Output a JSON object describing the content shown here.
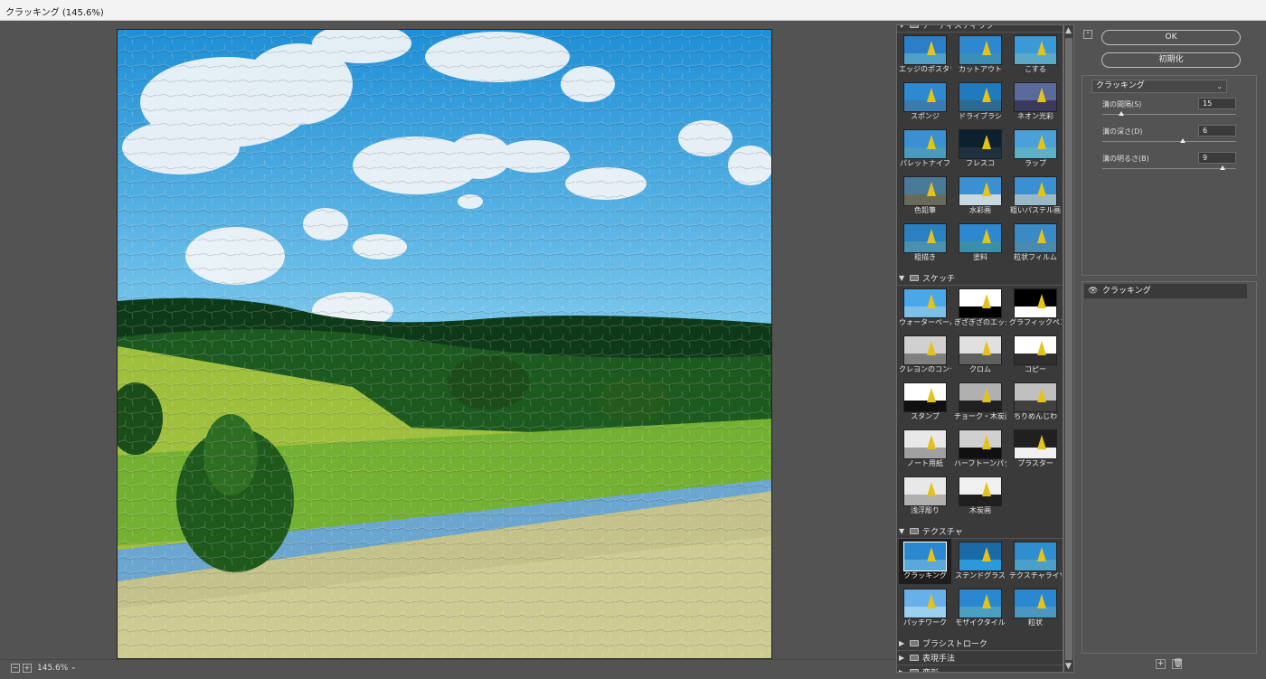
{
  "window": {
    "title": "クラッキング (145.6%)"
  },
  "status": {
    "zoom": "145.6%",
    "minus": "−",
    "plus": "+",
    "dropdown": "⌄"
  },
  "gallery": {
    "categories": [
      {
        "name": "アーティスティック",
        "expanded": true
      },
      {
        "name": "スケッチ",
        "expanded": true
      },
      {
        "name": "テクスチャ",
        "expanded": true
      },
      {
        "name": "ブラシストローク",
        "expanded": false
      },
      {
        "name": "表現手法",
        "expanded": false
      },
      {
        "name": "変形",
        "expanded": false
      }
    ],
    "artistic": [
      "エッジのポスタリゼーション",
      "カットアウト",
      "こする",
      "スポンジ",
      "ドライブラシ",
      "ネオン光彩",
      "パレットナイフ",
      "フレスコ",
      "ラップ",
      "色鉛筆",
      "水彩画",
      "粗いパステル画",
      "粗描き",
      "塗料",
      "粒状フィルム"
    ],
    "sketch": [
      "ウォーターペーパー",
      "ぎざぎざのエッジ",
      "グラフィックペン",
      "クレヨンのコンテ画",
      "クロム",
      "コピー",
      "スタンプ",
      "チョーク・木炭画",
      "ちりめんじわ",
      "ノート用紙",
      "ハーフトーンパターン",
      "プラスター",
      "浅浮彫り",
      "木炭画"
    ],
    "texture": [
      "クラッキング",
      "ステンドグラス",
      "テクスチャライザー",
      "パッチワーク",
      "モザイクタイル",
      "粒状"
    ],
    "selected": "クラッキング"
  },
  "dialog": {
    "ok_label": "OK",
    "reset_label": "初期化",
    "collapse_label": "⌃",
    "filter_select": "クラッキング",
    "params": [
      {
        "label": "溝の間隔(S)",
        "value": "15",
        "slider_fraction": 0.14
      },
      {
        "label": "溝の深さ(D)",
        "value": "6",
        "slider_fraction": 0.6
      },
      {
        "label": "溝の明るさ(B)",
        "value": "9",
        "slider_fraction": 0.9
      }
    ],
    "layer_name": "クラッキング",
    "new_layer_label": "+",
    "delete_layer_label": "🗑"
  }
}
